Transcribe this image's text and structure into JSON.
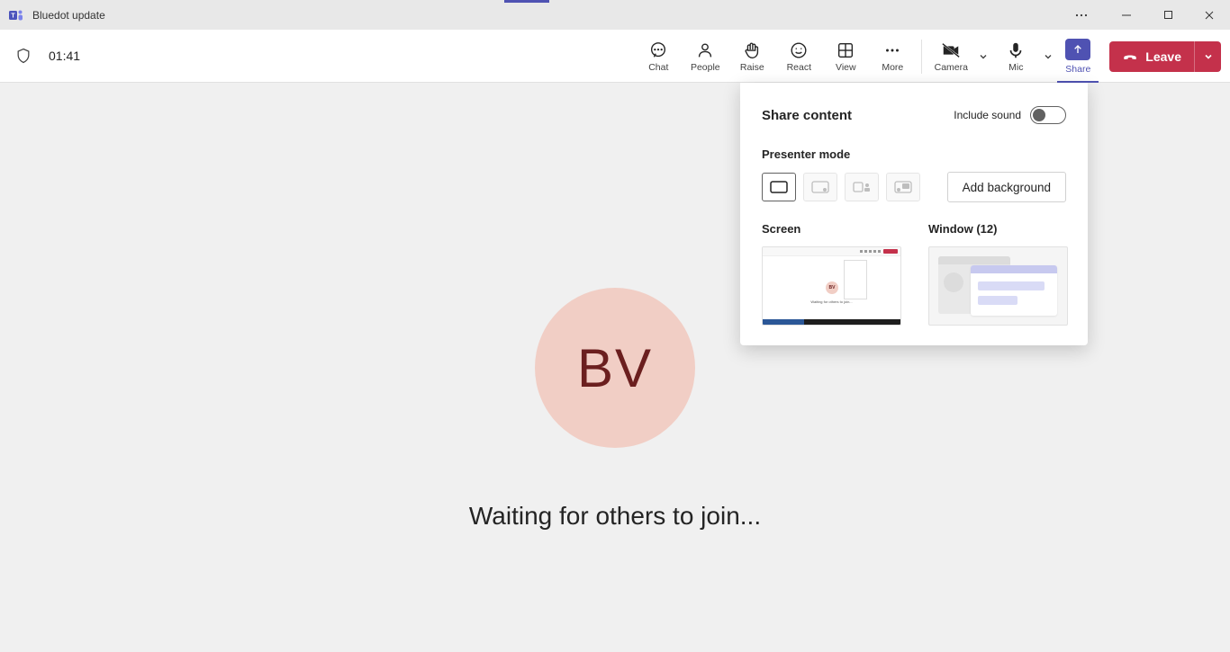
{
  "window": {
    "title": "Bluedot update"
  },
  "toolbar": {
    "timer": "01:41",
    "chat": "Chat",
    "people": "People",
    "raise": "Raise",
    "react": "React",
    "view": "View",
    "more": "More",
    "camera": "Camera",
    "mic": "Mic",
    "share": "Share",
    "leave": "Leave"
  },
  "stage": {
    "avatar_initials": "BV",
    "waiting_text": "Waiting for others to join..."
  },
  "share_panel": {
    "title": "Share content",
    "include_sound": "Include sound",
    "include_sound_on": false,
    "presenter_mode": "Presenter mode",
    "add_background": "Add background",
    "screen_label": "Screen",
    "window_label": "Window (12)",
    "thumb_avatar": "BV",
    "thumb_text": "Waiting for others to join..."
  }
}
